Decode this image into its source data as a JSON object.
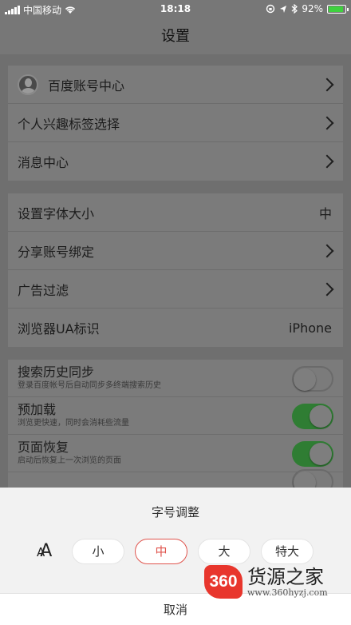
{
  "status_bar": {
    "carrier": "中国移动",
    "time": "18:18",
    "battery": "92%",
    "battery_level": 0.92
  },
  "nav": {
    "title": "设置"
  },
  "group1": [
    {
      "label": "百度账号中心",
      "icon": "avatar-icon"
    },
    {
      "label": "个人兴趣标签选择"
    },
    {
      "label": "消息中心"
    }
  ],
  "group2": [
    {
      "label": "设置字体大小",
      "value": "中"
    },
    {
      "label": "分享账号绑定"
    },
    {
      "label": "广告过滤"
    },
    {
      "label": "浏览器UA标识",
      "value": "iPhone"
    }
  ],
  "group3": [
    {
      "label": "搜索历史同步",
      "desc": "登录百度帐号后自动同步多终端搜索历史",
      "on": false
    },
    {
      "label": "预加载",
      "desc": "浏览更快速，同时会消耗些流量",
      "on": true
    },
    {
      "label": "页面恢复",
      "desc": "启动后恢复上一次浏览的页面",
      "on": true
    }
  ],
  "sheet": {
    "title": "字号调整",
    "sizes": [
      "小",
      "中",
      "大",
      "特大"
    ],
    "selected": "中",
    "cancel": "取消"
  },
  "watermark": {
    "logo": "360",
    "name": "货源之家",
    "url": "www.360hyzj.com"
  },
  "colors": {
    "accent": "#e0554e",
    "toggle_on": "#2f7d33",
    "logo": "#e8362d"
  }
}
